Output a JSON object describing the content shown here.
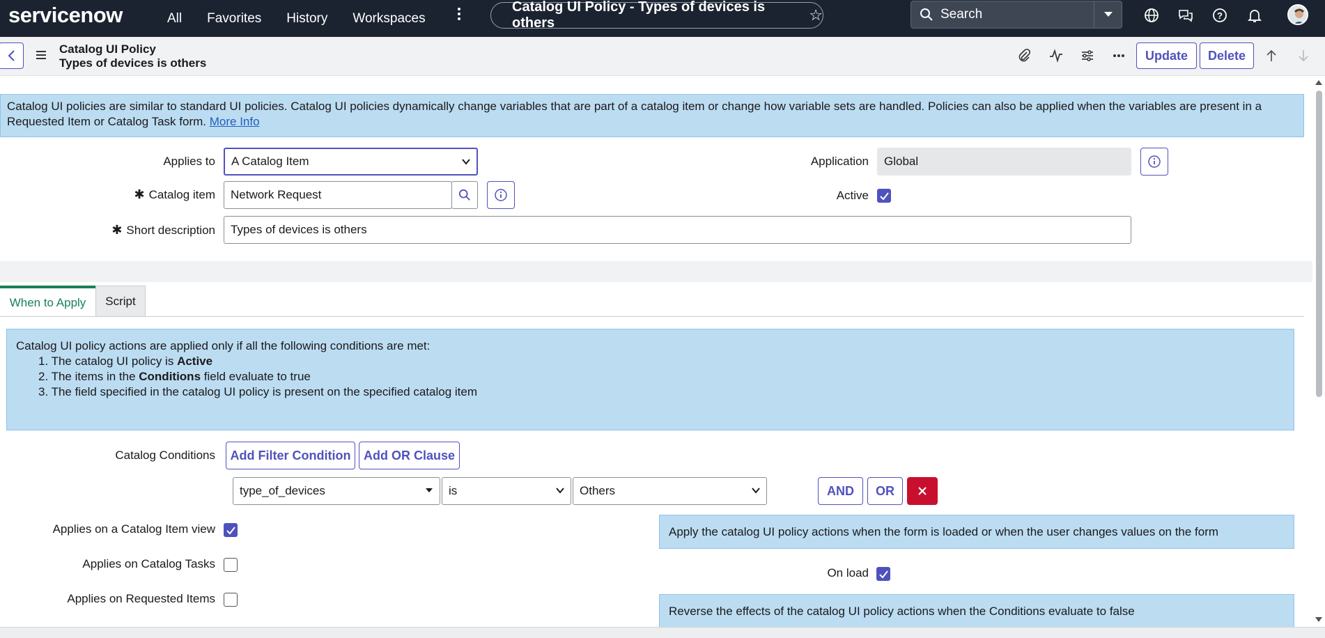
{
  "topnav": {
    "logo": "servicenow",
    "links": [
      "All",
      "Favorites",
      "History",
      "Workspaces"
    ],
    "record_pill": "Catalog UI Policy - Types of devices is others",
    "search_placeholder": "Search"
  },
  "record_header": {
    "table": "Catalog UI Policy",
    "name": "Types of devices is others",
    "update_label": "Update",
    "delete_label": "Delete"
  },
  "info_banner": {
    "text": "Catalog UI policies are similar to standard UI policies. Catalog UI policies dynamically change variables that are part of a catalog item or change how variable sets are handled. Policies can also be applied when the variables are present in a Requested Item or Catalog Task form.",
    "link": "More Info"
  },
  "form": {
    "applies_to_label": "Applies to",
    "applies_to_value": "A Catalog Item",
    "catalog_item_label": "Catalog item",
    "catalog_item_value": "Network Request",
    "short_description_label": "Short description",
    "short_description_value": "Types of devices is others",
    "application_label": "Application",
    "application_value": "Global",
    "active_label": "Active",
    "active_checked": true
  },
  "tabs": [
    "When to Apply",
    "Script"
  ],
  "conditions_banner": {
    "intro": "Catalog UI policy actions are applied only if all the following conditions are met:",
    "item1_prefix": "The catalog UI policy is ",
    "item1_bold": "Active",
    "item2_prefix": "The items in the ",
    "item2_bold": "Conditions",
    "item2_suffix": " field evaluate to true",
    "item3": "The field specified in the catalog UI policy is present on the specified catalog item"
  },
  "catalog_conditions": {
    "label": "Catalog Conditions",
    "add_filter_label": "Add Filter Condition",
    "add_or_label": "Add OR Clause",
    "field": "type_of_devices",
    "operator": "is",
    "value": "Others",
    "and_label": "AND",
    "or_label": "OR"
  },
  "applies": {
    "catalog_item_view_label": "Applies on a Catalog Item view",
    "catalog_item_view_checked": true,
    "catalog_tasks_label": "Applies on Catalog Tasks",
    "catalog_tasks_checked": false,
    "requested_items_label": "Applies on Requested Items",
    "requested_items_checked": false
  },
  "onload": {
    "banner": "Apply the catalog UI policy actions when the form is loaded or when the user changes values on the form",
    "label": "On load",
    "checked": true,
    "reverse_banner": "Reverse the effects of the catalog UI policy actions when the Conditions evaluate to false"
  },
  "colors": {
    "nav_bg": "#1c2330",
    "accent": "#4f52bd",
    "banner_bg": "#bcdcf2",
    "tab_active": "#1a7f5a",
    "delete_red": "#c8102e"
  }
}
